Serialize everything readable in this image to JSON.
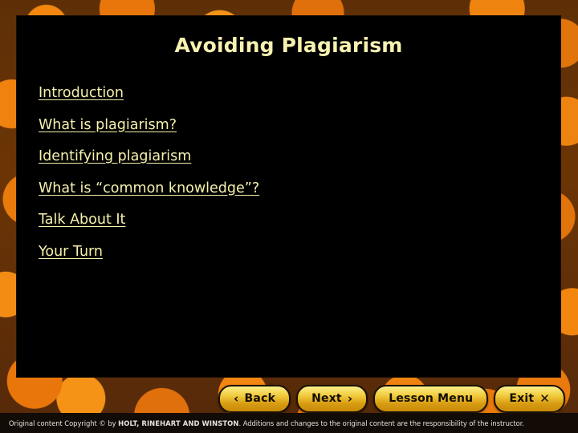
{
  "slide": {
    "title": "Avoiding Plagiarism",
    "title_color": "#F8F2B0",
    "panel_color": "#000000",
    "background_color": "#E8760A",
    "link_color": "#F7F1AD"
  },
  "links": [
    {
      "label": "Introduction"
    },
    {
      "label": "What is plagiarism?"
    },
    {
      "label": "Identifying plagiarism"
    },
    {
      "label": "What is “common knowledge”?"
    },
    {
      "label": "Talk About It"
    },
    {
      "label": "Your Turn"
    }
  ],
  "nav": {
    "back": {
      "label": "Back",
      "glyph": "‹"
    },
    "next": {
      "label": "Next",
      "glyph": "›"
    },
    "lesson_menu": {
      "label": "Lesson Menu"
    },
    "exit": {
      "label": "Exit",
      "glyph": "✕"
    },
    "button_color": "#F0C93A"
  },
  "footer": {
    "copyright_prefix": "Original content Copyright © by ",
    "publisher": "HOLT, RINEHART AND WINSTON",
    "copyright_suffix": ". Additions and changes to the original content are the responsibility of the instructor."
  }
}
